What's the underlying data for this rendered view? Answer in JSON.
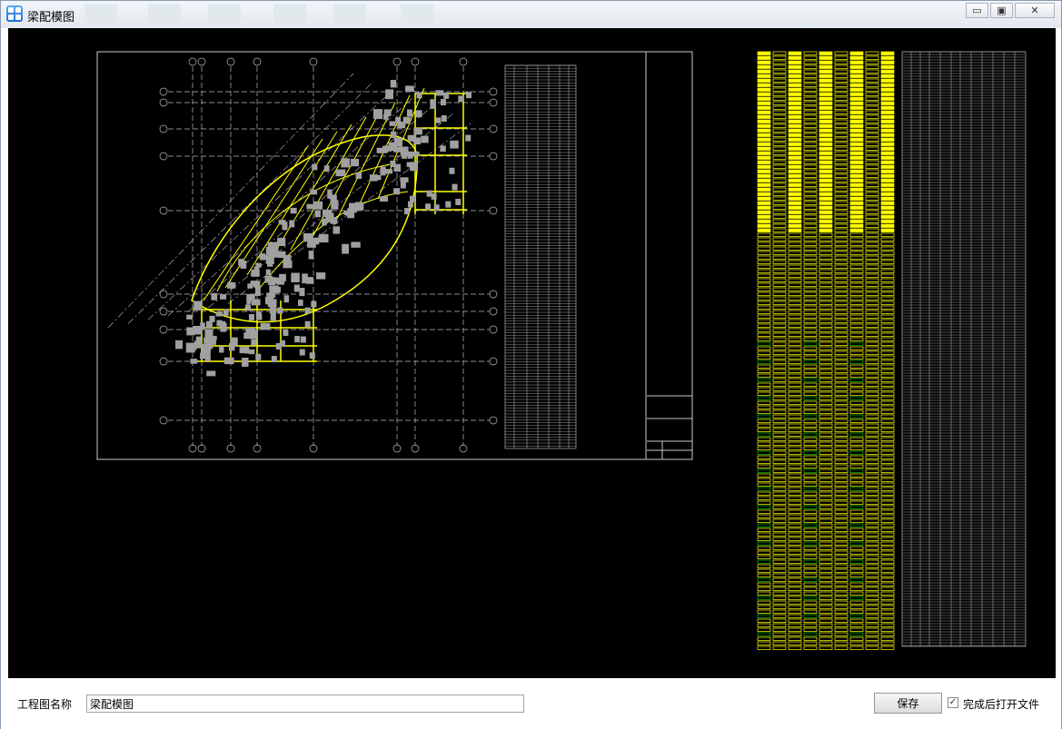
{
  "window": {
    "title": "梁配模图",
    "icon": "app-grid-icon",
    "controls": {
      "minimize": "minimize-icon",
      "maximize": "maximize-icon",
      "close": "close-icon"
    }
  },
  "form": {
    "project_name_label": "工程图名称",
    "project_name_value": "梁配模图",
    "save_label": "保存",
    "open_after_label": "完成后打开文件",
    "open_after_checked": true
  },
  "colors": {
    "canvas_bg": "#000000",
    "drawing_lines": "#c8c8c8",
    "beam_yellow": "#ffff00",
    "column_gray": "#a0a0a0",
    "accent_green": "#00c000"
  }
}
